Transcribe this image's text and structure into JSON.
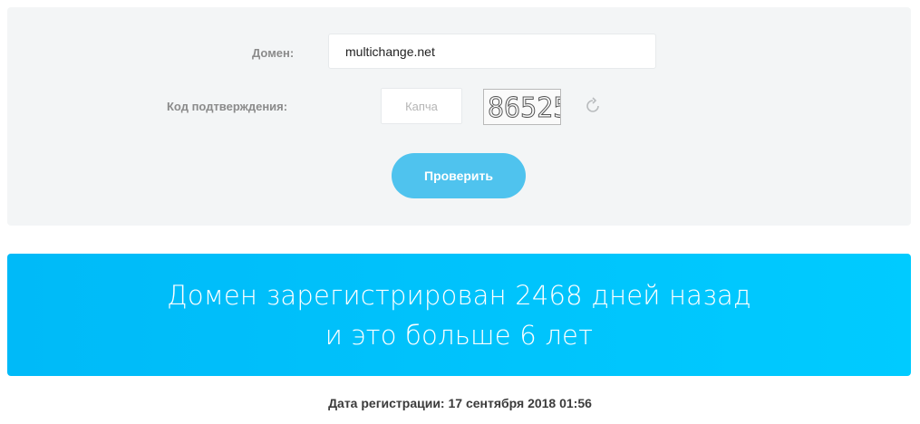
{
  "form": {
    "domain_label": "Домен:",
    "domain_value": "multichange.net",
    "captcha_label": "Код подтверждения:",
    "captcha_placeholder": "Капча",
    "captcha_image_text": "86525",
    "refresh_icon": "refresh-icon",
    "submit_label": "Проверить"
  },
  "result": {
    "line1": "Домен зарегистрирован 2468 дней назад",
    "line2": "и это больше 6 лет"
  },
  "registration": {
    "text": "Дата регистрации: 17 сентября 2018 01:56"
  },
  "colors": {
    "panel_bg": "#f3f5f6",
    "button": "#4fc3ee",
    "banner": "#00c2fc"
  }
}
